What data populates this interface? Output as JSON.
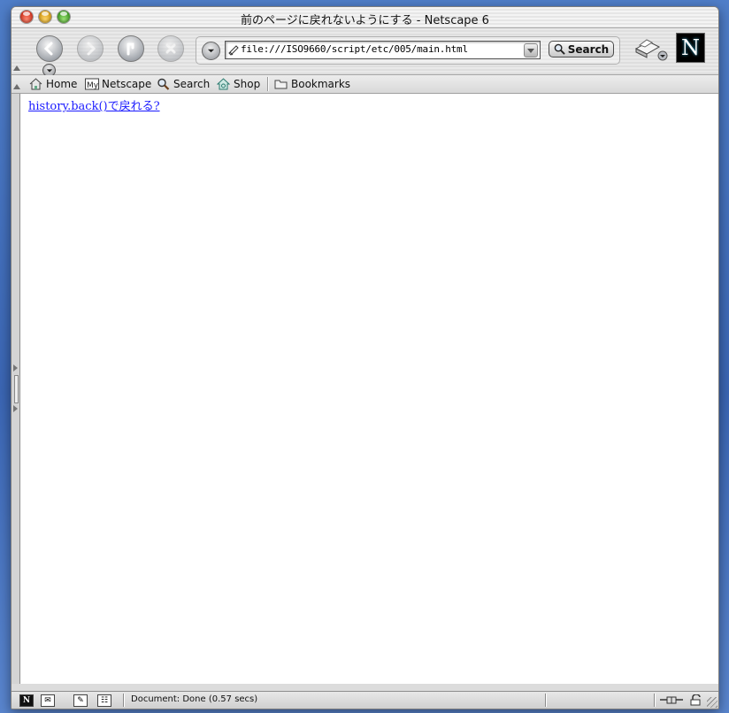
{
  "window": {
    "title": "前のページに戻れないようにする - Netscape 6"
  },
  "toolbar": {
    "back_icon": "back-arrow-icon",
    "forward_icon": "forward-arrow-icon",
    "reload_icon": "reload-icon",
    "stop_icon": "stop-icon",
    "url": "file:///ISO9660/script/etc/005/main.html",
    "search_label": "Search"
  },
  "personal_toolbar": {
    "items": [
      {
        "label": "Home",
        "icon": "home-icon"
      },
      {
        "label": "Netscape",
        "icon": "my-netscape-icon"
      },
      {
        "label": "Search",
        "icon": "magnifier-icon"
      },
      {
        "label": "Shop",
        "icon": "shop-icon"
      }
    ],
    "bookmarks_label": "Bookmarks"
  },
  "content": {
    "link_text": "history.back()で戻れる?"
  },
  "status": {
    "text": "Document: Done (0.57 secs)"
  },
  "colors": {
    "link": "#1a1aff",
    "desktop": "#3b66b4"
  }
}
